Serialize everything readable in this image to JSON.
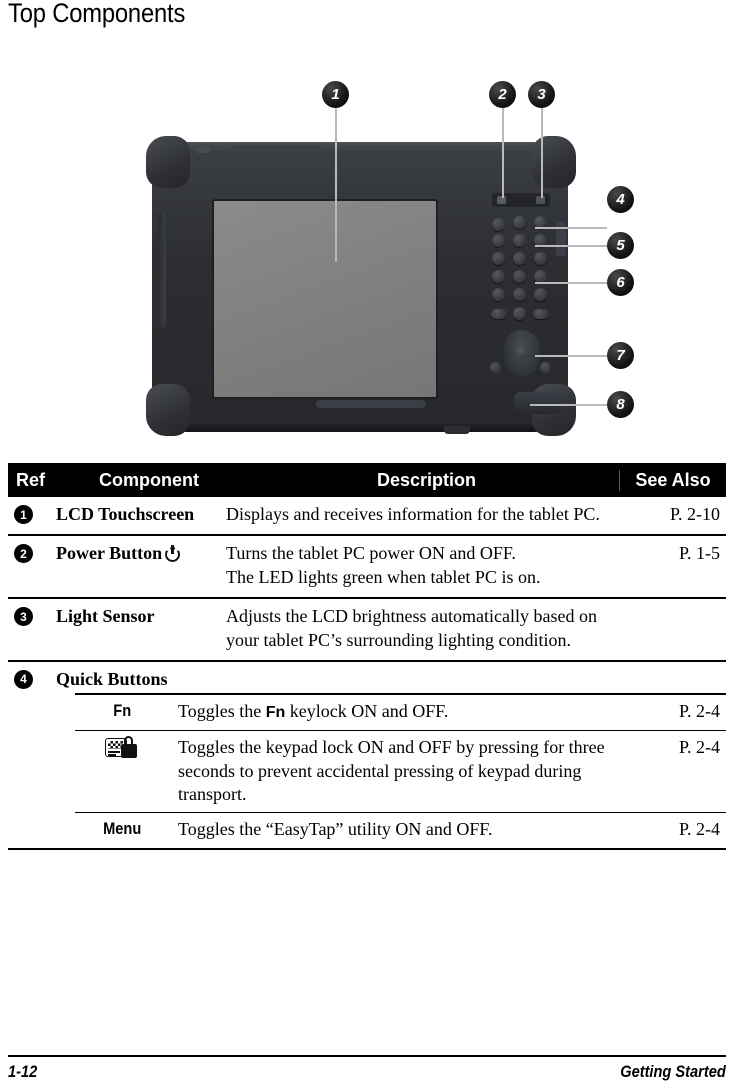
{
  "page": {
    "title": "Top Components"
  },
  "figure": {
    "alt_name": "rugged-tablet-pc-top-view",
    "callouts": [
      {
        "id": "1",
        "label": "1"
      },
      {
        "id": "2",
        "label": "2"
      },
      {
        "id": "3",
        "label": "3"
      },
      {
        "id": "4",
        "label": "4"
      },
      {
        "id": "5",
        "label": "5"
      },
      {
        "id": "6",
        "label": "6"
      },
      {
        "id": "7",
        "label": "7"
      },
      {
        "id": "8",
        "label": "8"
      }
    ]
  },
  "table": {
    "headers": {
      "ref": "Ref",
      "component": "Component",
      "description": "Description",
      "see_also": "See Also"
    },
    "rows": [
      {
        "ref": "❶",
        "ref_number": "1",
        "component": "LCD Touchscreen",
        "description": "Displays and receives information for the tablet PC.",
        "see_also": "P. 2-10"
      },
      {
        "ref": "❷",
        "ref_number": "2",
        "component": "Power Button",
        "component_icon": "power-icon",
        "description_line1": "Turns the tablet PC power ON and OFF.",
        "description_line2": "The LED lights green when tablet PC is on.",
        "see_also": "P. 1-5"
      },
      {
        "ref": "❸",
        "ref_number": "3",
        "component": "Light Sensor",
        "description": "Adjusts the LCD brightness automatically based on your tablet PC’s surrounding lighting condition.",
        "see_also": ""
      },
      {
        "ref": "❹",
        "ref_number": "4",
        "component": "Quick Buttons",
        "description": "",
        "see_also": ""
      }
    ],
    "sub_rows": [
      {
        "key": "Fn",
        "key_type": "text",
        "description_pre": "Toggles the ",
        "description_bold": "Fn",
        "description_post": " keylock ON and OFF.",
        "see_also": "P. 2-4"
      },
      {
        "key": "",
        "key_type": "keypad-lock-icon",
        "description": "Toggles the keypad lock ON and OFF by pressing for three seconds to prevent accidental pressing of keypad during transport.",
        "see_also": "P. 2-4"
      },
      {
        "key": "Menu",
        "key_type": "text",
        "description": "Toggles the “EasyTap” utility ON and OFF.",
        "see_also": "P. 2-4"
      }
    ]
  },
  "footer": {
    "page_number": "1-12",
    "section": "Getting Started"
  }
}
